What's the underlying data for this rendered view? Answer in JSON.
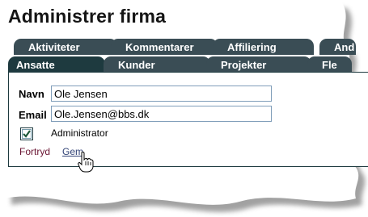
{
  "page": {
    "title": "Administrer firma"
  },
  "tabs_back": [
    {
      "label": "Aktiviteter"
    },
    {
      "label": "Kommentarer"
    },
    {
      "label": "Affiliering"
    },
    {
      "label": "And"
    }
  ],
  "tabs_front": [
    {
      "label": "Ansatte",
      "active": true
    },
    {
      "label": "Kunder"
    },
    {
      "label": "Projekter"
    },
    {
      "label": "Fle"
    }
  ],
  "form": {
    "name_label": "Navn",
    "name_value": "Ole Jensen",
    "email_label": "Email",
    "email_value": "Ole.Jensen@bbs.dk",
    "admin_label": "Administrator",
    "admin_checked": true
  },
  "actions": {
    "cancel_label": "Fortryd",
    "save_label": "Gem"
  },
  "colors": {
    "tab_active": "#1e3a3f",
    "tab_inactive": "#3a4d55",
    "link": "#6a1533"
  }
}
